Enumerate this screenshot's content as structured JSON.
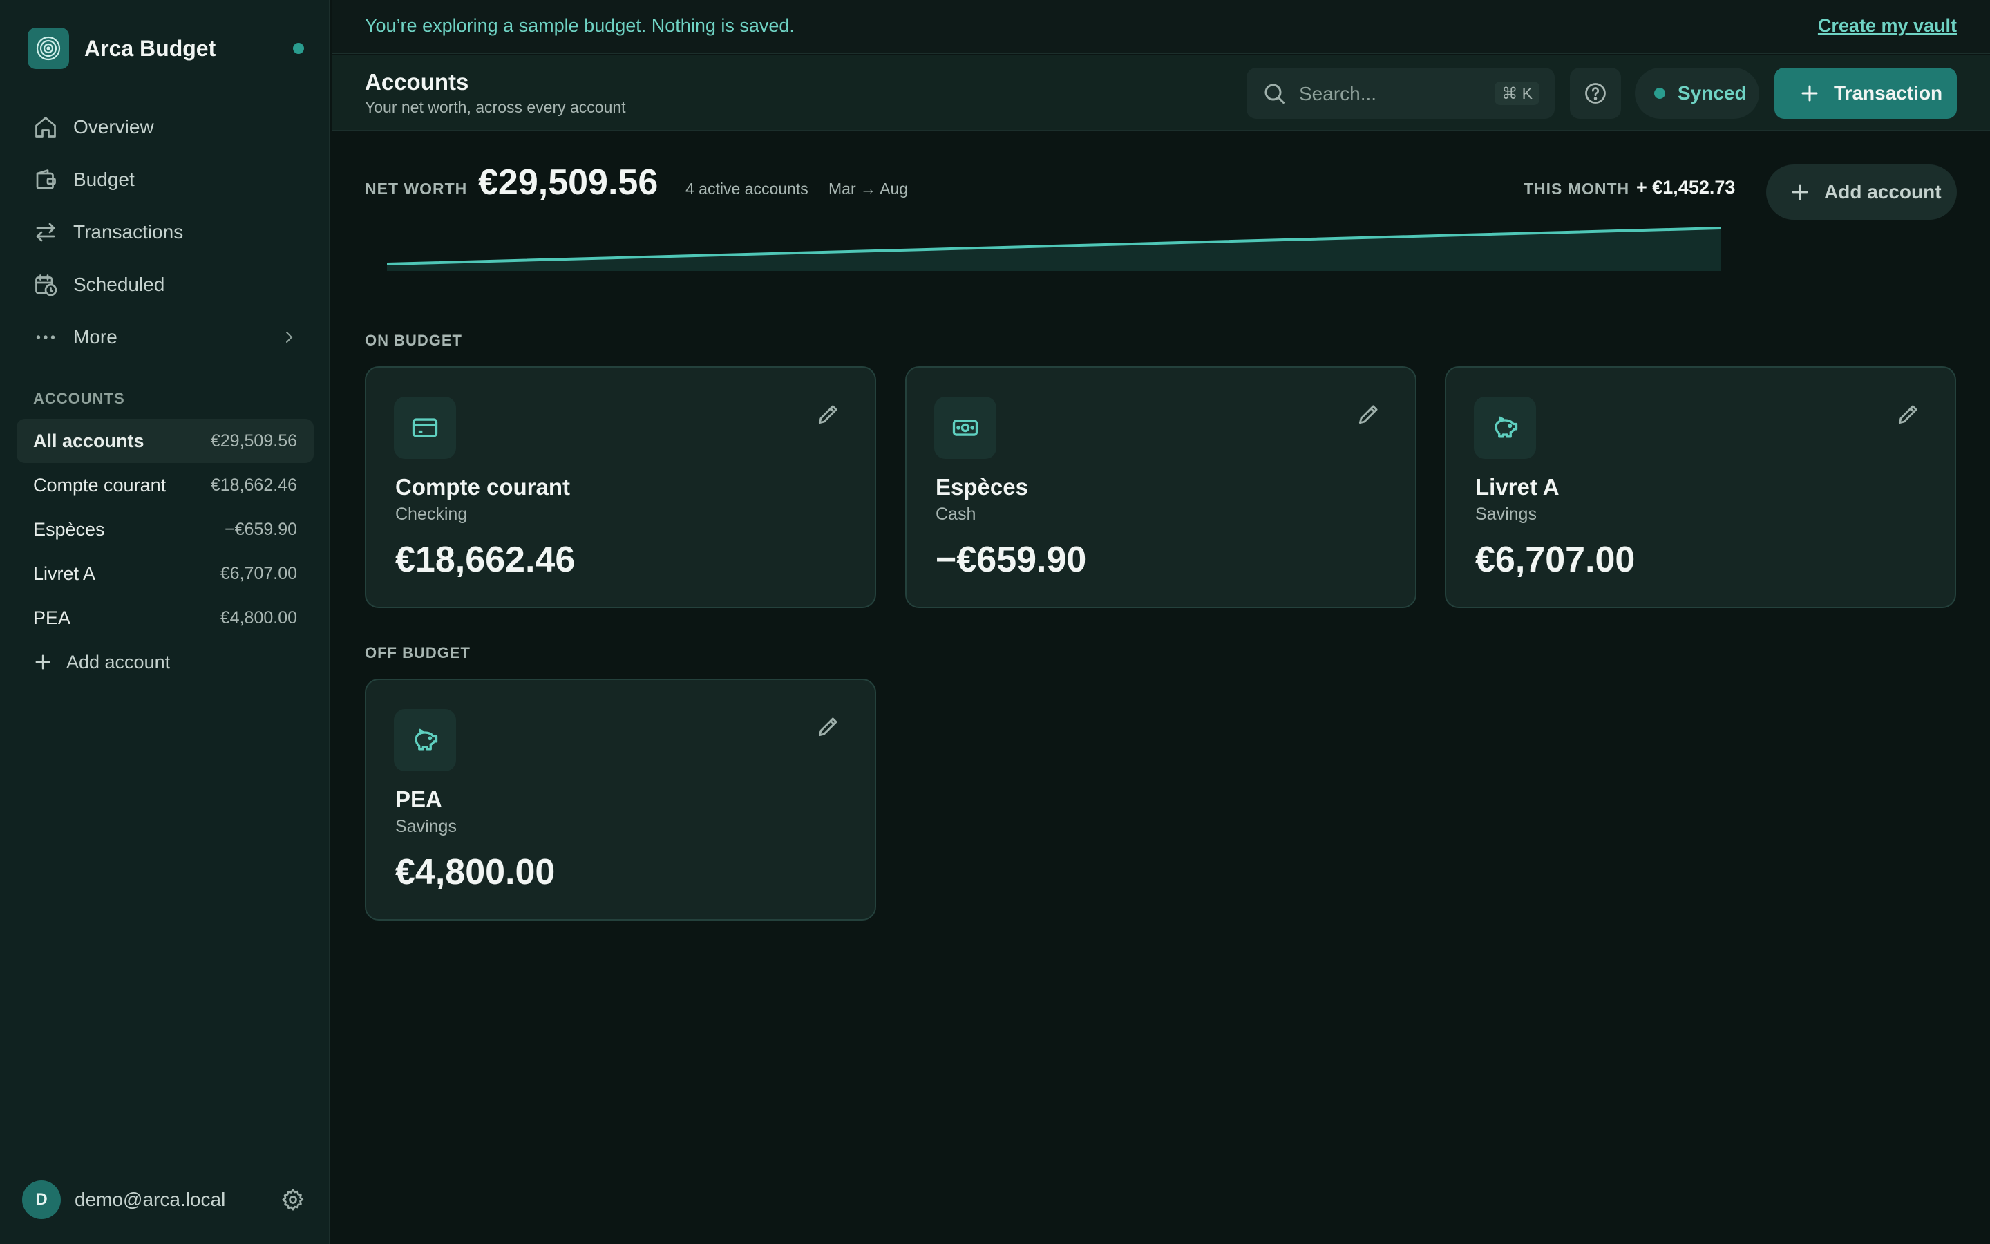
{
  "app": {
    "name": "Arca Budget"
  },
  "sidebar": {
    "nav": [
      {
        "label": "Overview",
        "icon": "home-icon"
      },
      {
        "label": "Budget",
        "icon": "wallet-icon"
      },
      {
        "label": "Transactions",
        "icon": "arrows-swap-icon"
      },
      {
        "label": "Scheduled",
        "icon": "calendar-clock-icon"
      },
      {
        "label": "More",
        "icon": "more-dots-icon"
      }
    ],
    "accounts_header": "ACCOUNTS",
    "accounts": [
      {
        "name": "All accounts",
        "balance": "€29,509.56",
        "active": true
      },
      {
        "name": "Compte courant",
        "balance": "€18,662.46"
      },
      {
        "name": "Espèces",
        "balance": "−€659.90"
      },
      {
        "name": "Livret A",
        "balance": "€6,707.00"
      },
      {
        "name": "PEA",
        "balance": "€4,800.00"
      }
    ],
    "add_account": "Add account",
    "user": {
      "initial": "D",
      "email": "demo@arca.local"
    }
  },
  "banner": {
    "text": "You’re exploring a sample budget. Nothing is saved.",
    "link": "Create my vault"
  },
  "header": {
    "title": "Accounts",
    "subtitle": "Your net worth, across every account",
    "search_placeholder": "Search...",
    "search_shortcut": "⌘ K",
    "sync_status": "Synced",
    "transaction_button": "Transaction"
  },
  "net_worth": {
    "label": "NET WORTH",
    "value": "€29,509.56",
    "active_accounts": "4 active accounts",
    "range": "Mar → Aug",
    "this_month_label": "THIS MONTH",
    "this_month_value": "+ €1,452.73",
    "add_account": "Add account",
    "trend": [
      0,
      0.2,
      0.4,
      0.6,
      0.8,
      1.0
    ]
  },
  "sections": {
    "on_budget_label": "ON BUDGET",
    "off_budget_label": "OFF BUDGET"
  },
  "cards": [
    {
      "name": "Compte courant",
      "type": "Checking",
      "balance": "€18,662.46",
      "icon": "credit-card-icon"
    },
    {
      "name": "Espèces",
      "type": "Cash",
      "balance": "−€659.90",
      "icon": "cash-icon"
    },
    {
      "name": "Livret A",
      "type": "Savings",
      "balance": "€6,707.00",
      "icon": "piggy-bank-icon"
    },
    {
      "name": "PEA",
      "type": "Savings",
      "balance": "€4,800.00",
      "icon": "piggy-bank-icon"
    }
  ],
  "colors": {
    "accent": "#2a9d8f",
    "primary_button": "#1f7a72",
    "banner_text": "#6fd3c4"
  }
}
